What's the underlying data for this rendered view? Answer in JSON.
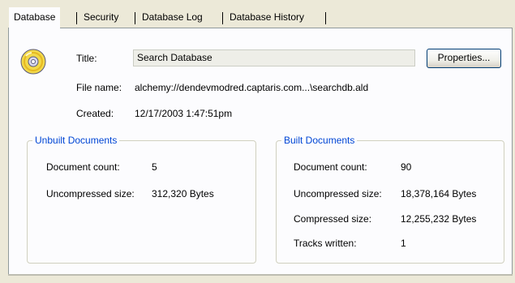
{
  "tabs": [
    {
      "label": "Database",
      "active": true
    },
    {
      "label": "Security",
      "active": false
    },
    {
      "label": "Database Log",
      "active": false
    },
    {
      "label": "Database History",
      "active": false
    }
  ],
  "header": {
    "title_label": "Title:",
    "title_value": "Search Database",
    "properties_button": "Properties...",
    "filename_label": "File name:",
    "filename_value": "alchemy://dendevmodred.captaris.com...\\searchdb.ald",
    "created_label": "Created:",
    "created_value": "12/17/2003 1:47:51pm"
  },
  "unbuilt": {
    "title": "Unbuilt Documents",
    "doc_count_label": "Document count:",
    "doc_count_value": "5",
    "uncompressed_label": "Uncompressed size:",
    "uncompressed_value": "312,320 Bytes"
  },
  "built": {
    "title": "Built Documents",
    "doc_count_label": "Document count:",
    "doc_count_value": "90",
    "uncompressed_label": "Uncompressed size:",
    "uncompressed_value": "18,378,164 Bytes",
    "compressed_label": "Compressed size:",
    "compressed_value": "12,255,232 Bytes",
    "tracks_label": "Tracks written:",
    "tracks_value": "1"
  },
  "icons": {
    "database": "cd-disc-icon"
  },
  "colors": {
    "group_title": "#0046d5",
    "panel": "#fcfcfe",
    "window": "#ece9d8"
  }
}
